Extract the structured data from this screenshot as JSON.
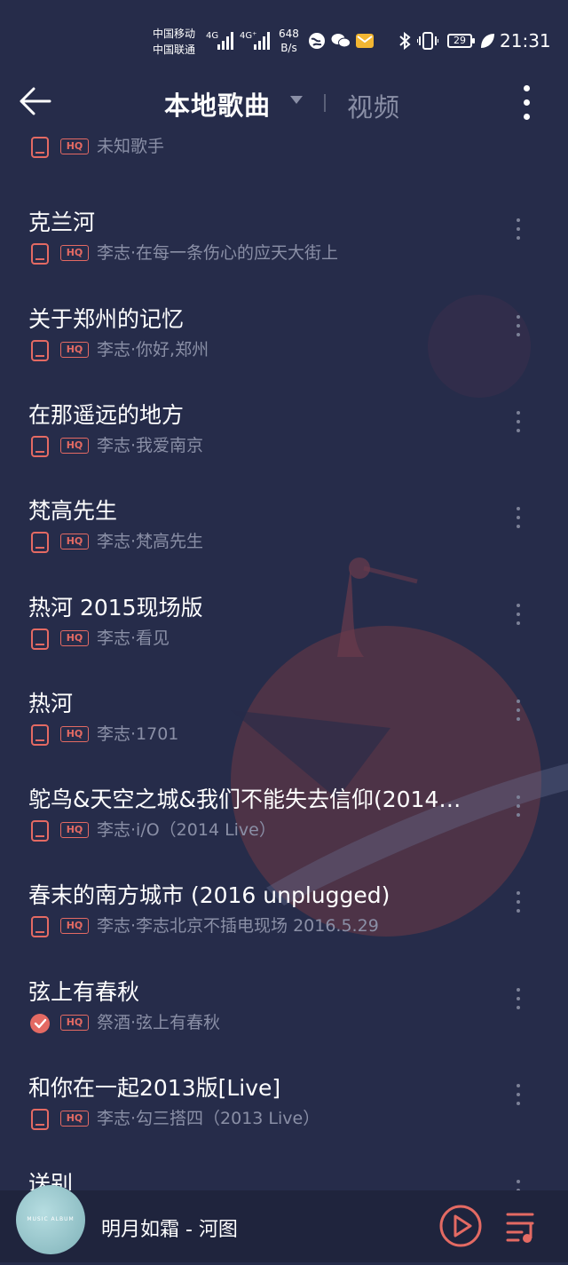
{
  "status_bar": {
    "carrier_1": "中国移动",
    "carrier_2": "中国联通",
    "sig_1": "4G",
    "sig_2": "4G⁺",
    "net_speed_value": "648",
    "net_speed_unit": "B/s",
    "battery": "29",
    "time": "21:31",
    "icons": [
      "browser-icon",
      "wechat-icon",
      "mail-icon",
      "bluetooth-icon",
      "vibrate-icon",
      "battery-icon",
      "leaf-icon"
    ]
  },
  "header": {
    "title": "本地歌曲",
    "tab_video": "视频"
  },
  "songs": [
    {
      "title": "",
      "artist": "未知歌手",
      "downloaded": false
    },
    {
      "title": "克兰河",
      "artist": "李志·在每一条伤心的应天大街上",
      "downloaded": false
    },
    {
      "title": "关于郑州的记忆",
      "artist": "李志·你好,郑州",
      "downloaded": false
    },
    {
      "title": "在那遥远的地方",
      "artist": "李志·我爱南京",
      "downloaded": false
    },
    {
      "title": "梵高先生",
      "artist": "李志·梵高先生",
      "downloaded": false
    },
    {
      "title": "热河 2015现场版",
      "artist": "李志·看见",
      "downloaded": false
    },
    {
      "title": "热河",
      "artist": "李志·1701",
      "downloaded": false
    },
    {
      "title": "鸵鸟&天空之城&我们不能失去信仰(2014…",
      "artist": "李志·i/O（2014 Live）",
      "downloaded": false
    },
    {
      "title": "春末的南方城市 (2016 unplugged)",
      "artist": "李志·李志北京不插电现场 2016.5.29",
      "downloaded": false
    },
    {
      "title": "弦上有春秋",
      "artist": "祭酒·弦上有春秋",
      "downloaded": true
    },
    {
      "title": "和你在一起2013版[Live]",
      "artist": "李志·勾三搭四（2013 Live）",
      "downloaded": false
    },
    {
      "title": "送别",
      "artist": "",
      "downloaded": false
    }
  ],
  "quality_badge": "HQ",
  "player": {
    "album_text": "MUSIC ALBUM",
    "now_playing": "明月如霜 - 河图"
  },
  "colors": {
    "background": "#262c4a",
    "accent": "#e46a63",
    "muted": "#8a8fa6"
  }
}
